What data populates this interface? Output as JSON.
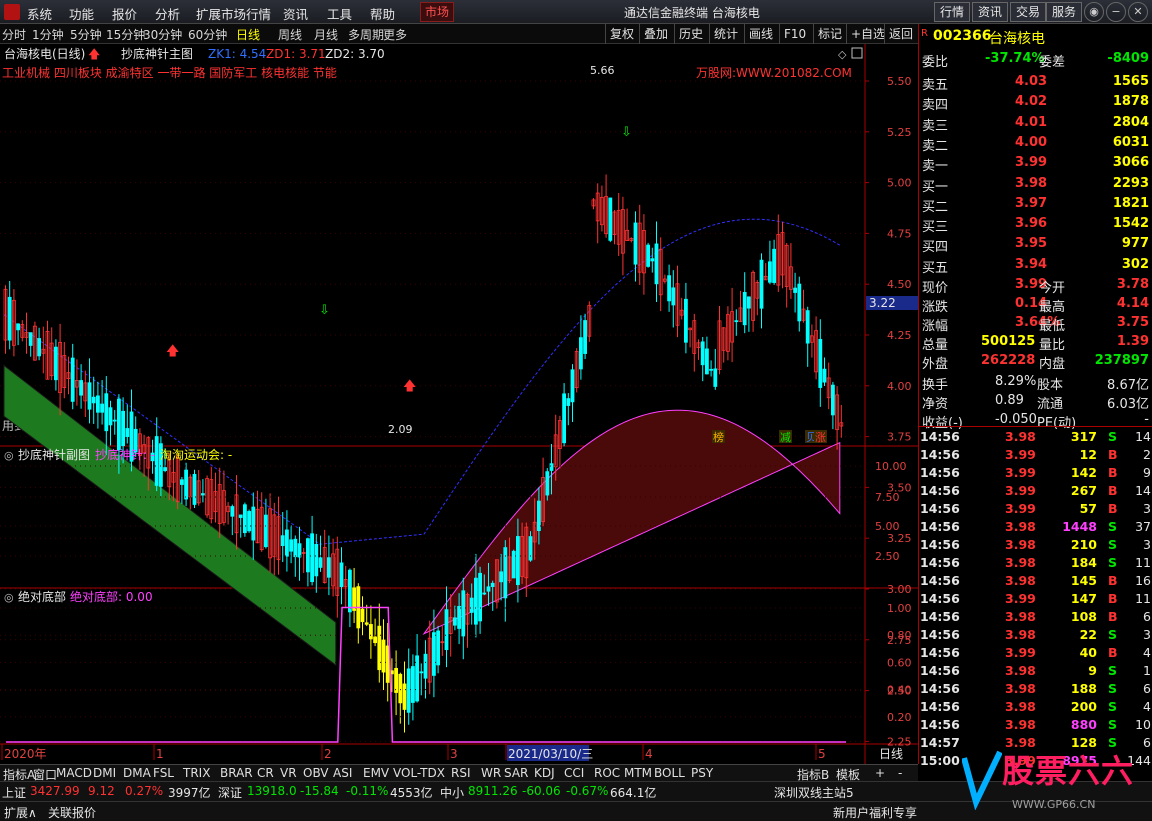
{
  "menu": {
    "items": [
      "系统",
      "功能",
      "报价",
      "分析",
      "扩展市场行情",
      "资讯",
      "工具",
      "帮助"
    ],
    "market": "市场",
    "title": "通达信金融终端  台海核电",
    "right_buttons": [
      "行情",
      "资讯",
      "交易",
      "服务"
    ]
  },
  "toolbar": {
    "periods": [
      "分时",
      "1分钟",
      "5分钟",
      "15分钟",
      "30分钟",
      "60分钟",
      "日线",
      "周线",
      "月线",
      "多周期",
      "更多"
    ],
    "active_period": "日线",
    "buttons": [
      "复权",
      "叠加",
      "历史",
      "统计",
      "画线",
      "F10",
      "标记",
      "+自选",
      "返回"
    ]
  },
  "main_panel": {
    "title": "台海核电(日线)",
    "indicator": "抄底神针主图",
    "zk1": "ZK1: 4.54",
    "zd1": "ZD1: 3.71",
    "zd2": "ZD2: 3.70",
    "sectors": "工业机械 四川板块 成渝特区 一带一路 国防军工 核电核能 节能",
    "watermark": "万股网:WWW.201082.COM",
    "future_note": "用到未来数据",
    "high_label": "5.66",
    "low_label": "2.09",
    "price_tag": "3.22",
    "y_ticks": [
      "5.50",
      "5.25",
      "5.00",
      "4.75",
      "4.50",
      "4.25",
      "4.00",
      "3.75",
      "3.50",
      "3.25",
      "3.00",
      "2.75",
      "2.50",
      "2.25"
    ],
    "tags": [
      "榜",
      "减",
      "贝",
      "涨"
    ],
    "colors": {
      "up": "#ff3232",
      "down": "#00ffff",
      "yellow": "#ffff00",
      "green_band": "#1e7a1e",
      "red_band": "#4a0a0a",
      "ma_blue": "#3030ff",
      "ma_mag": "#ff40ff"
    }
  },
  "sub1": {
    "title": "抄底神针副图",
    "l1": "抄底神针: -",
    "l2": "淘淘运动会: -",
    "y_ticks": [
      "10.00",
      "7.50",
      "5.00",
      "2.50"
    ]
  },
  "sub2": {
    "title": "绝对底部",
    "label": "绝对底部: 0.00",
    "y_ticks": [
      "1.00",
      "0.80",
      "0.60",
      "0.40",
      "0.20"
    ],
    "bottom_signal": [
      0,
      0,
      0,
      0,
      0,
      0,
      0,
      0,
      0,
      0,
      0,
      0,
      0,
      0,
      0,
      0,
      0,
      0,
      0,
      0,
      0,
      0,
      0,
      0,
      0,
      0,
      0,
      0,
      0,
      0,
      0,
      0,
      0,
      0,
      0,
      0,
      0,
      0,
      0,
      0,
      0,
      0,
      0,
      0,
      0,
      0,
      0,
      0,
      0,
      0,
      0,
      0,
      0,
      0,
      0,
      0,
      0,
      0,
      0,
      0,
      0,
      0,
      0,
      0,
      0,
      0,
      0,
      0,
      0,
      0,
      0,
      0,
      0,
      0,
      0,
      0,
      0,
      0,
      0,
      0,
      1,
      1,
      1,
      1,
      1,
      1,
      1,
      1,
      1,
      1,
      1,
      1,
      0,
      0,
      0,
      0,
      0,
      0,
      0,
      0,
      0,
      0,
      0,
      0,
      0,
      0,
      0,
      0,
      0,
      0,
      0,
      0,
      0,
      0,
      0,
      0,
      0,
      0,
      0,
      0,
      0,
      0,
      0,
      0,
      0,
      0,
      0,
      0,
      0,
      0,
      0,
      0,
      0,
      0,
      0,
      0,
      0,
      0,
      0,
      0,
      0,
      0,
      0,
      0,
      0,
      0,
      0,
      0,
      0,
      0,
      0,
      0,
      0,
      0,
      0,
      0,
      0,
      0,
      0,
      0,
      0,
      0,
      0,
      0,
      0,
      0,
      0,
      0,
      0,
      0,
      0,
      0,
      0,
      0,
      0,
      0,
      0,
      0,
      0,
      0,
      0,
      0,
      0,
      0,
      0,
      0,
      0,
      0,
      0,
      0,
      0,
      0,
      0,
      0,
      0,
      0,
      0,
      0,
      0,
      0,
      0
    ]
  },
  "xaxis": {
    "labels": [
      "2020年",
      "1",
      "2",
      "3",
      "2021/03/10/三",
      "4",
      "5"
    ],
    "right": "日线"
  },
  "indicator_tabs": [
    "指标A",
    "窗口",
    "MACD",
    "DMI",
    "DMA",
    "FSL",
    "TRIX",
    "BRAR",
    "CR",
    "VR",
    "OBV",
    "ASI",
    "EMV",
    "VOL-TDX",
    "RSI",
    "WR",
    "SAR",
    "KDJ",
    "CCI",
    "ROC",
    "MTM",
    "BOLL",
    "PSY"
  ],
  "indicator_tabs_right": [
    "指标B",
    "模板",
    "+",
    "-"
  ],
  "quote": {
    "code": "002366",
    "name": "台海核电",
    "weibi": "委比",
    "weibi_val": "-37.74%",
    "weicha": "委差",
    "weicha_val": "-8409",
    "asks": [
      {
        "l": "卖五",
        "p": "4.03",
        "v": "1565"
      },
      {
        "l": "卖四",
        "p": "4.02",
        "v": "1878"
      },
      {
        "l": "卖三",
        "p": "4.01",
        "v": "2804"
      },
      {
        "l": "卖二",
        "p": "4.00",
        "v": "6031"
      },
      {
        "l": "卖一",
        "p": "3.99",
        "v": "3066"
      }
    ],
    "bids": [
      {
        "l": "买一",
        "p": "3.98",
        "v": "2293"
      },
      {
        "l": "买二",
        "p": "3.97",
        "v": "1821"
      },
      {
        "l": "买三",
        "p": "3.96",
        "v": "1542"
      },
      {
        "l": "买四",
        "p": "3.95",
        "v": "977"
      },
      {
        "l": "买五",
        "p": "3.94",
        "v": "302"
      }
    ],
    "stats": [
      {
        "a": "现价",
        "av": "3.99",
        "b": "今开",
        "bv": "3.78"
      },
      {
        "a": "涨跌",
        "av": "0.14",
        "b": "最高",
        "bv": "4.14"
      },
      {
        "a": "涨幅",
        "av": "3.64%",
        "b": "最低",
        "bv": "3.75"
      },
      {
        "a": "总量",
        "av": "500125",
        "b": "量比",
        "bv": "1.39"
      },
      {
        "a": "外盘",
        "av": "262228",
        "b": "内盘",
        "bv": "237897"
      }
    ],
    "fund": [
      {
        "a": "换手",
        "av": "8.29%",
        "b": "股本",
        "bv": "8.67亿"
      },
      {
        "a": "净资",
        "av": "0.89",
        "b": "流通",
        "bv": "6.03亿"
      },
      {
        "a": "收益(-)",
        "av": "-0.050",
        "b": "PE(动)",
        "bv": "-"
      }
    ],
    "ticks": [
      {
        "t": "14:56",
        "p": "3.98",
        "v": "317",
        "s": "S",
        "n": "14"
      },
      {
        "t": "14:56",
        "p": "3.99",
        "v": "12",
        "s": "B",
        "n": "2"
      },
      {
        "t": "14:56",
        "p": "3.99",
        "v": "142",
        "s": "B",
        "n": "9"
      },
      {
        "t": "14:56",
        "p": "3.99",
        "v": "267",
        "s": "B",
        "n": "14"
      },
      {
        "t": "14:56",
        "p": "3.99",
        "v": "57",
        "s": "B",
        "n": "3"
      },
      {
        "t": "14:56",
        "p": "3.98",
        "v": "1448",
        "s": "S",
        "n": "37"
      },
      {
        "t": "14:56",
        "p": "3.98",
        "v": "210",
        "s": "S",
        "n": "3"
      },
      {
        "t": "14:56",
        "p": "3.98",
        "v": "184",
        "s": "S",
        "n": "11"
      },
      {
        "t": "14:56",
        "p": "3.98",
        "v": "145",
        "s": "B",
        "n": "16"
      },
      {
        "t": "14:56",
        "p": "3.99",
        "v": "147",
        "s": "B",
        "n": "11"
      },
      {
        "t": "14:56",
        "p": "3.98",
        "v": "108",
        "s": "B",
        "n": "6"
      },
      {
        "t": "14:56",
        "p": "3.98",
        "v": "22",
        "s": "S",
        "n": "3"
      },
      {
        "t": "14:56",
        "p": "3.99",
        "v": "40",
        "s": "B",
        "n": "4"
      },
      {
        "t": "14:56",
        "p": "3.98",
        "v": "9",
        "s": "S",
        "n": "1"
      },
      {
        "t": "14:56",
        "p": "3.98",
        "v": "188",
        "s": "S",
        "n": "6"
      },
      {
        "t": "14:56",
        "p": "3.98",
        "v": "200",
        "s": "S",
        "n": "4"
      },
      {
        "t": "14:56",
        "p": "3.98",
        "v": "880",
        "s": "S",
        "n": "10"
      },
      {
        "t": "14:57",
        "p": "3.98",
        "v": "128",
        "s": "S",
        "n": "6"
      },
      {
        "t": "15:00",
        "p": "3.99",
        "v": "8975",
        "s": "",
        "n": "144"
      }
    ]
  },
  "status": {
    "sh": "上证",
    "sh_v": "3427.99",
    "sh_c": "9.12",
    "sh_p": "0.27%",
    "sh_a": "3997亿",
    "sz": "深证",
    "sz_v": "13918.0",
    "sz_c": "-15.84",
    "sz_p": "-0.11%",
    "sz_a": "4553亿",
    "zx": "中小",
    "zx_v": "8911.26",
    "zx_c": "-60.06",
    "zx_p": "-0.67%",
    "zx_a": "664.1亿",
    "server": "深圳双线主站5"
  },
  "bottom": {
    "expand": "扩展∧",
    "related": "关联报价",
    "news": "新用户福利专享"
  },
  "brand": {
    "text": "股票六六",
    "url": "WWW.GP66.CN"
  }
}
